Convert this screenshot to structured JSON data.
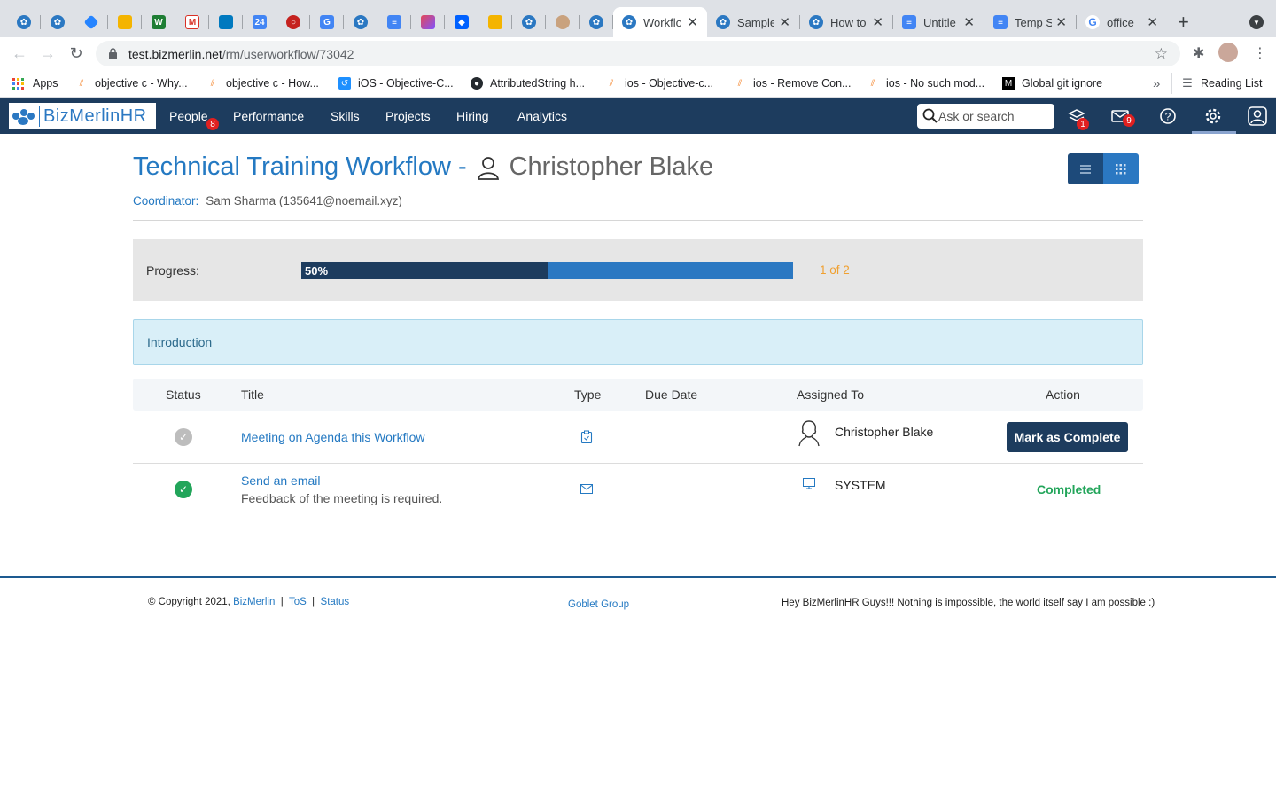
{
  "browser": {
    "tabs": [
      {
        "title": "Workflo",
        "active": true
      },
      {
        "title": "Sample",
        "active": false
      },
      {
        "title": "How to",
        "active": false
      },
      {
        "title": "Untitle",
        "active": false
      },
      {
        "title": "Temp S",
        "active": false
      },
      {
        "title": "office",
        "active": false
      }
    ],
    "url_host": "test.bizmerlin.net",
    "url_path": "/rm/userworkflow/73042",
    "bookmarks": [
      "Apps",
      "objective c - Why...",
      "objective c - How...",
      "iOS - Objective-C...",
      "AttributedString h...",
      "ios - Objective-c...",
      "ios - Remove Con...",
      "ios - No such mod...",
      "Global git ignore"
    ],
    "overflow": "»",
    "reading_list": "Reading List"
  },
  "app": {
    "logo_text": "BizMerlinHR",
    "nav": [
      {
        "label": "People",
        "badge": "8"
      },
      {
        "label": "Performance"
      },
      {
        "label": "Skills"
      },
      {
        "label": "Projects"
      },
      {
        "label": "Hiring"
      },
      {
        "label": "Analytics"
      }
    ],
    "search_placeholder": "Ask or search",
    "layers_badge": "1",
    "mail_badge": "9"
  },
  "workflow": {
    "title": "Technical Training Workflow -",
    "person": "Christopher Blake",
    "coordinator_label": "Coordinator:",
    "coordinator_value": "Sam Sharma (135641@noemail.xyz)",
    "progress_label": "Progress:",
    "progress_percent": 50,
    "progress_text": "50%",
    "progress_count": "1 of 2",
    "section": "Introduction"
  },
  "table": {
    "headers": [
      "Status",
      "Title",
      "Type",
      "Due Date",
      "Assigned To",
      "Action"
    ],
    "rows": [
      {
        "status": "pending",
        "title": "Meeting on Agenda this Workflow",
        "subtitle": "",
        "type_icon": "clipboard-icon",
        "due": "",
        "assignee_icon": "user-avatar-icon",
        "assignee": "Christopher Blake",
        "action": "Mark as Complete"
      },
      {
        "status": "completed",
        "title": "Send an email",
        "subtitle": "Feedback of the meeting is required.",
        "type_icon": "envelope-icon",
        "due": "",
        "assignee_icon": "monitor-icon",
        "assignee": "SYSTEM",
        "action": "Completed"
      }
    ]
  },
  "footer": {
    "copyright": "© Copyright 2021,",
    "brand_link": "BizMerlin",
    "sep": "|",
    "tos": "ToS",
    "status": "Status",
    "center": "Goblet Group",
    "right": "Hey BizMerlinHR Guys!!! Nothing is impossible, the world itself say I am possible :)"
  },
  "colors": {
    "nav_bg": "#1d3c5e",
    "accent": "#2479c2",
    "progress_fill": "#1d3c5e",
    "progress_track": "#2b78c2",
    "success": "#22a55a",
    "count": "#f0a030"
  }
}
